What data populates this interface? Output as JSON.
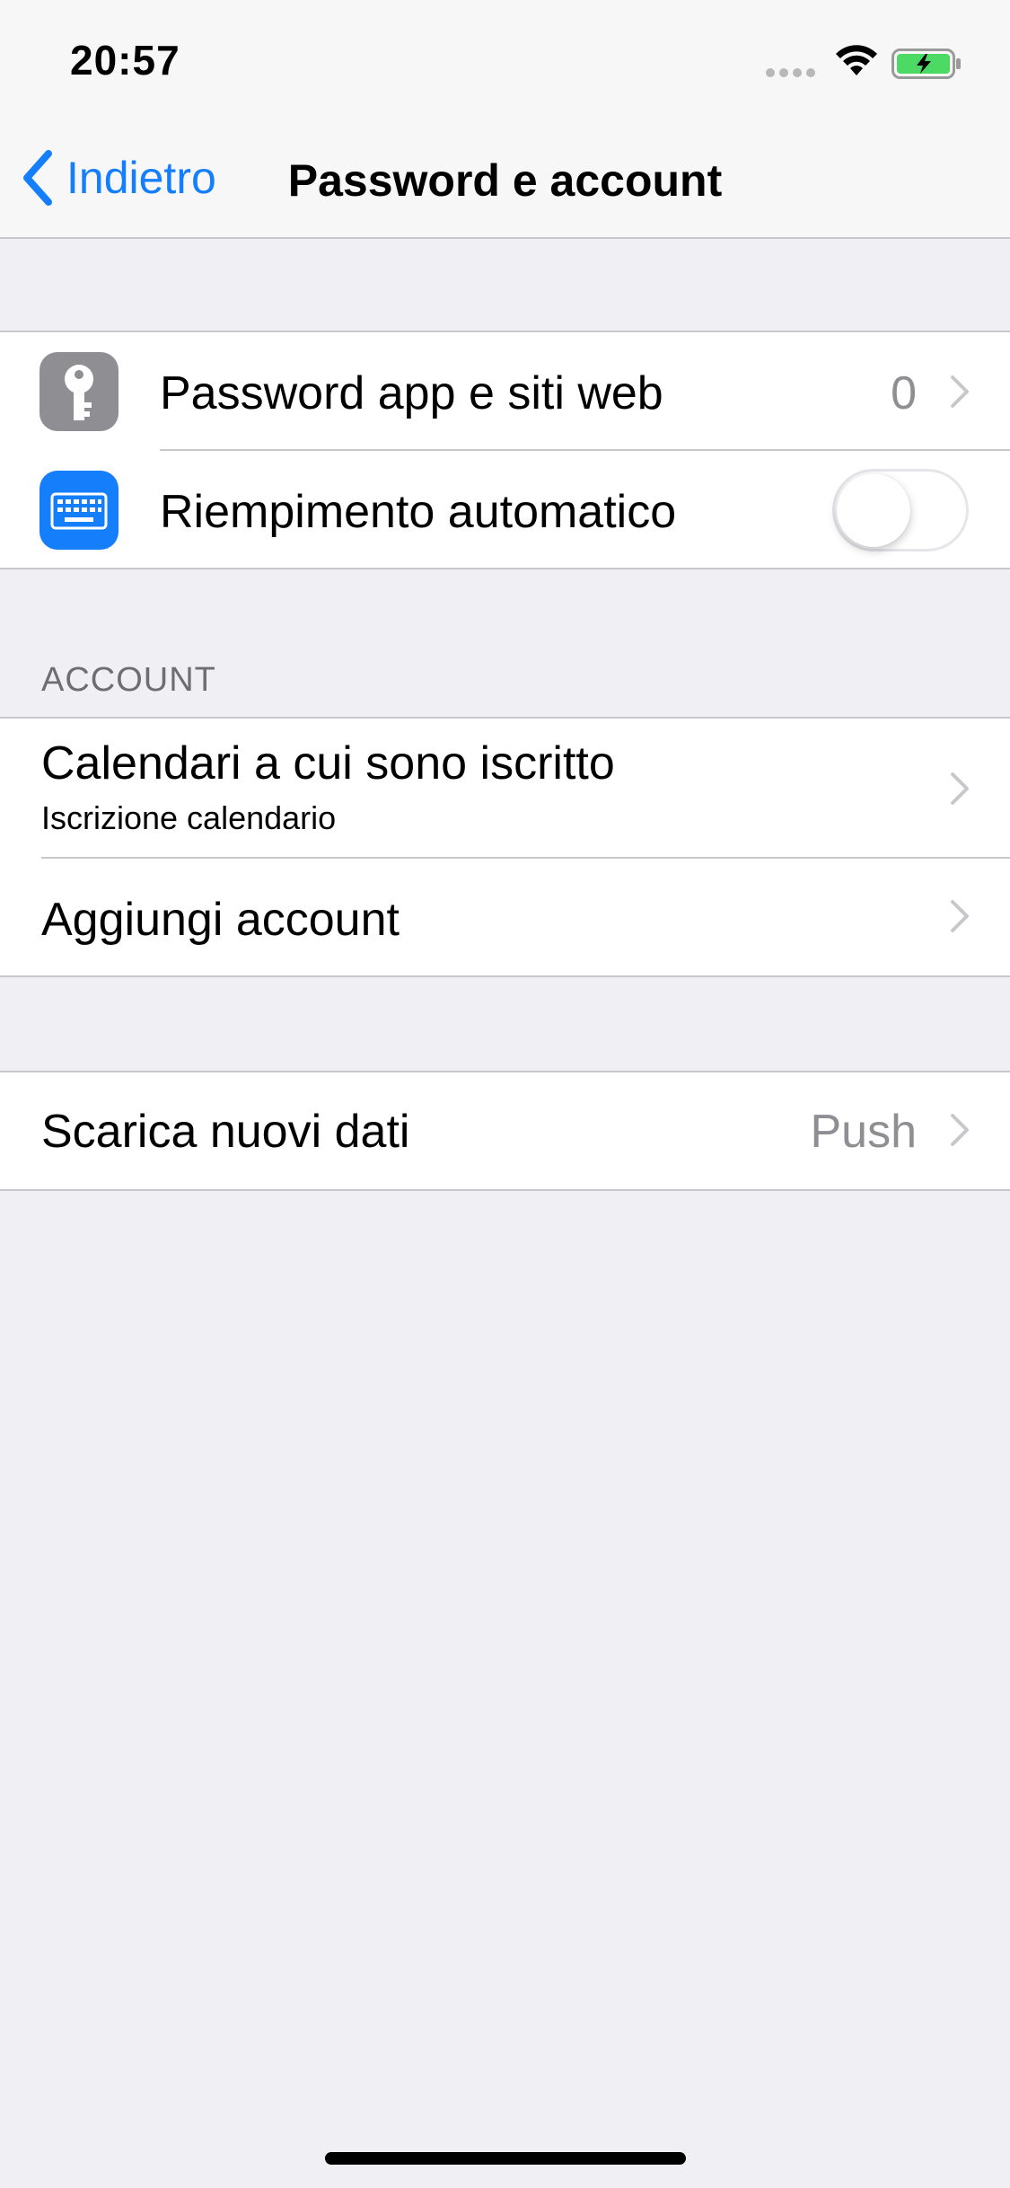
{
  "status_bar": {
    "time": "20:57",
    "signal_icon": "signal-dots-icon",
    "wifi_icon": "wifi-icon",
    "battery_icon": "battery-charging-icon",
    "battery_color": "#4CD964"
  },
  "nav": {
    "back_label": "Indietro",
    "title": "Password e account",
    "accent_color": "#147EFB"
  },
  "group1": {
    "passwords": {
      "label": "Password app e siti web",
      "value": "0",
      "icon": "key-icon",
      "icon_color": "#8E8E93"
    },
    "autofill": {
      "label": "Riempimento automatico",
      "icon": "keyboard-icon",
      "icon_color": "#147EFB",
      "toggle_on": false
    }
  },
  "accounts_section": {
    "header": "ACCOUNT",
    "items": [
      {
        "label": "Calendari a cui sono iscritto",
        "subtitle": "Iscrizione calendario"
      },
      {
        "label": "Aggiungi account"
      }
    ]
  },
  "fetch": {
    "label": "Scarica nuovi dati",
    "value": "Push"
  }
}
